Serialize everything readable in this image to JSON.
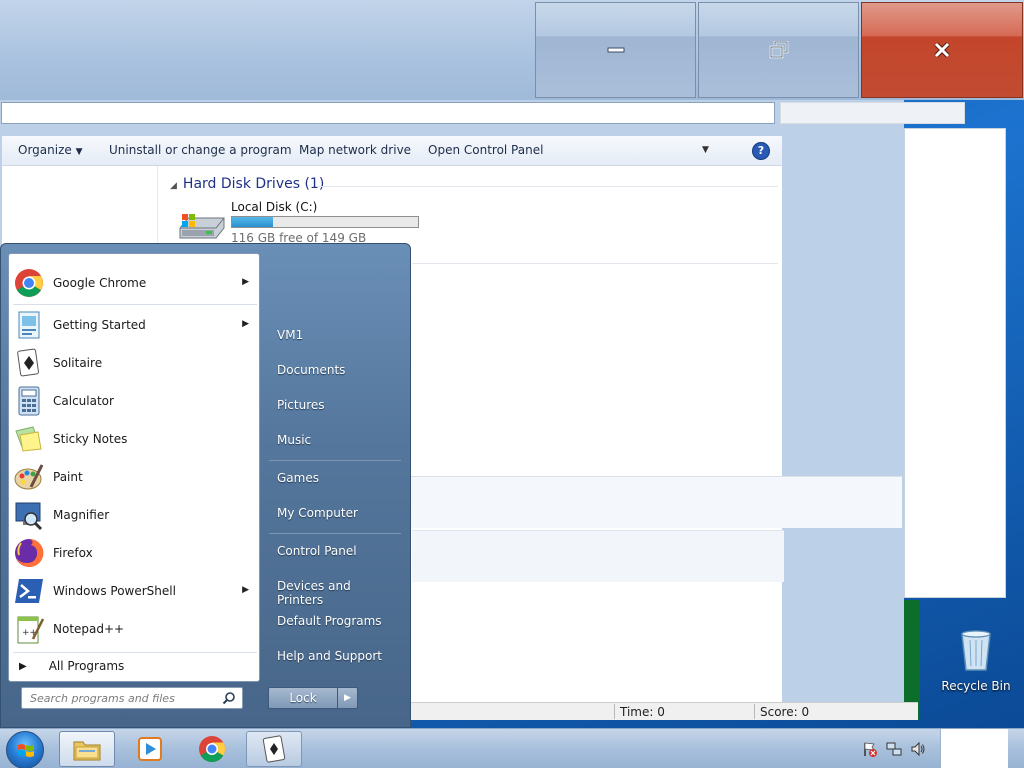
{
  "explorer": {
    "toolbar": {
      "organize": "Organize",
      "uninstall": "Uninstall or change a program",
      "map_drive": "Map network drive",
      "open_cp": "Open Control Panel"
    },
    "group": {
      "title": "Hard Disk Drives (1)"
    },
    "drive": {
      "name": "Local Disk (C:)",
      "free_text": "116 GB free of 149 GB",
      "used_fraction": 0.22
    }
  },
  "solitaire": {
    "status": {
      "time": "Time:   0",
      "score": "Score: 0"
    }
  },
  "desktop": {
    "recycle_bin": "Recycle Bin"
  },
  "start_menu": {
    "programs": [
      {
        "label": "Google Chrome",
        "icon": "chrome-icon",
        "has_submenu": true
      },
      {
        "label": "Getting Started",
        "icon": "getting-started-icon",
        "has_submenu": true
      },
      {
        "label": "Solitaire",
        "icon": "solitaire-icon",
        "has_submenu": false
      },
      {
        "label": "Calculator",
        "icon": "calculator-icon",
        "has_submenu": false
      },
      {
        "label": "Sticky Notes",
        "icon": "sticky-notes-icon",
        "has_submenu": false
      },
      {
        "label": "Paint",
        "icon": "paint-icon",
        "has_submenu": false
      },
      {
        "label": "Magnifier",
        "icon": "magnifier-icon",
        "has_submenu": false
      },
      {
        "label": "Firefox",
        "icon": "firefox-icon",
        "has_submenu": false
      },
      {
        "label": "Windows PowerShell",
        "icon": "powershell-icon",
        "has_submenu": true
      },
      {
        "label": "Notepad++",
        "icon": "notepad-plus-plus-icon",
        "has_submenu": false
      }
    ],
    "all_programs": "All Programs",
    "search_placeholder": "Search programs and files",
    "right": {
      "user": "VM1",
      "documents": "Documents",
      "pictures": "Pictures",
      "music": "Music",
      "games": "Games",
      "my_computer": "My Computer",
      "control_panel": "Control Panel",
      "devices": "Devices and Printers",
      "default_programs": "Default Programs",
      "help": "Help and Support"
    },
    "lock": "Lock"
  },
  "colors": {
    "accent": "#2a8fd0",
    "close_red": "#c3462c",
    "start_menu": "#55779d"
  }
}
